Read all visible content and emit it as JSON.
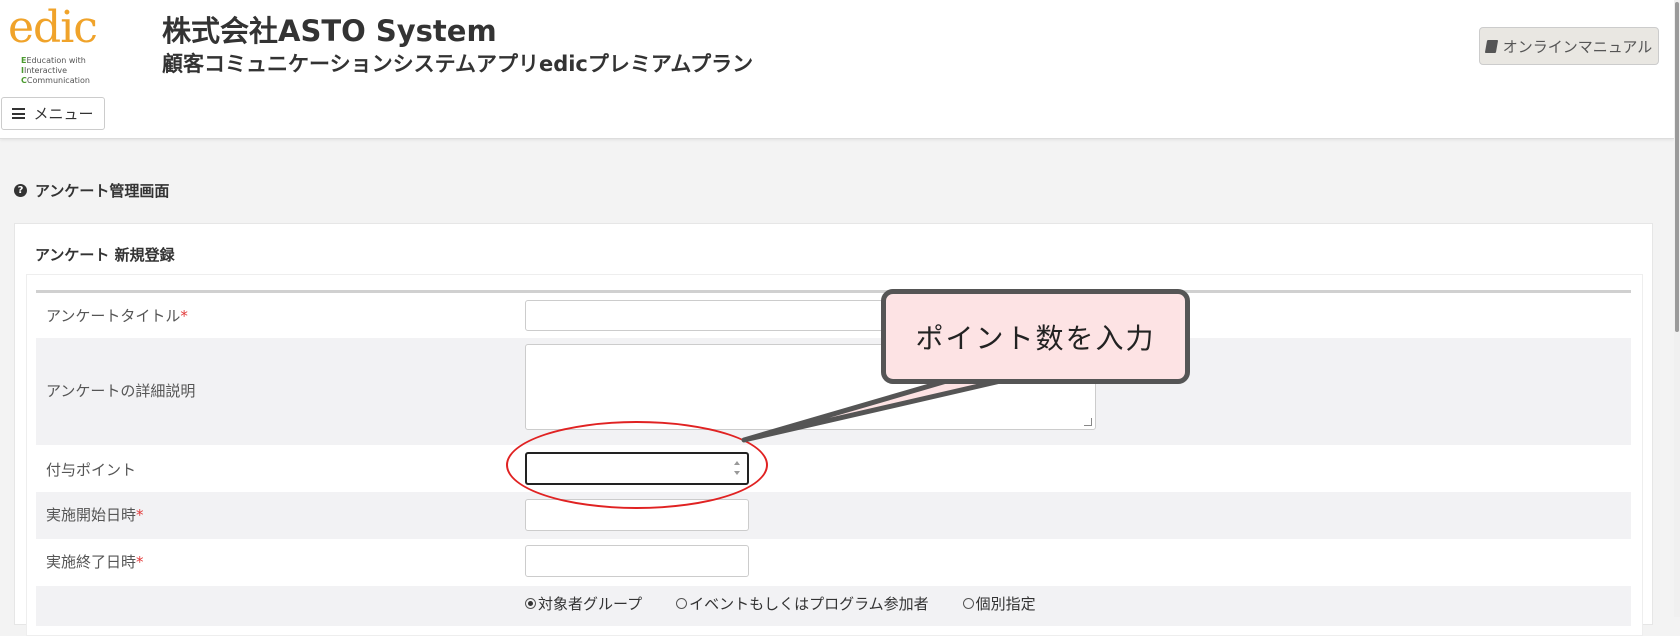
{
  "header": {
    "logo_word": "edic",
    "logo_sub": [
      "Education with",
      "Interactive",
      "Communication"
    ],
    "company_name": "株式会社ASTO System",
    "app_name": "顧客コミュニケーションシステムアプリedicプレミアムプラン",
    "menu_label": "メニュー",
    "manual_label": "オンラインマニュアル"
  },
  "page": {
    "title": "アンケート管理画面"
  },
  "form": {
    "heading": "アンケート 新規登録",
    "fields": {
      "title_label": "アンケートタイトル",
      "description_label": "アンケートの詳細説明",
      "points_label": "付与ポイント",
      "start_label": "実施開始日時",
      "end_label": "実施終了日時",
      "required_mark": "*"
    },
    "target_options": [
      {
        "label": "対象者グループ",
        "selected": true
      },
      {
        "label": "イベントもしくはプログラム参加者",
        "selected": false
      },
      {
        "label": "個別指定",
        "selected": false
      }
    ]
  },
  "annotation": {
    "callout_text": "ポイント数を入力",
    "callout_fill": "#fde3e4",
    "highlight_color": "#e02222"
  },
  "colors": {
    "logo_orange": "#f0a32a",
    "required_red": "#e23b3b"
  }
}
